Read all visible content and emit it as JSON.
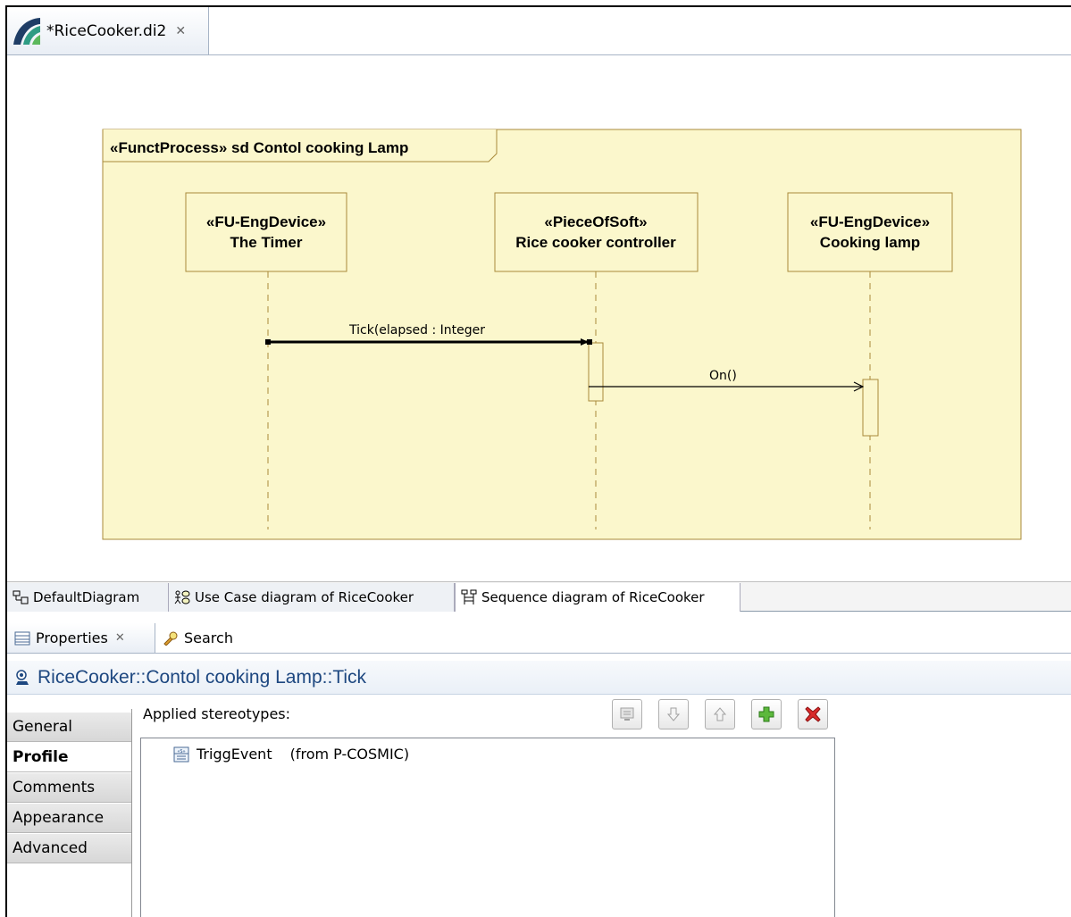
{
  "editor": {
    "tab_title": "*RiceCooker.di2"
  },
  "diagram": {
    "frame_label": "«FunctProcess»  sd  Contol cooking Lamp",
    "lifelines": [
      {
        "stereotype": "«FU-EngDevice»",
        "name": "The Timer"
      },
      {
        "stereotype": "«PieceOfSoft»",
        "name": "Rice cooker controller"
      },
      {
        "stereotype": "«FU-EngDevice»",
        "name": "Cooking lamp"
      }
    ],
    "messages": [
      {
        "label": "Tick(elapsed : Integer"
      },
      {
        "label": "On()"
      }
    ],
    "colors": {
      "fill": "#fbf7cc",
      "border": "#a88a3a"
    }
  },
  "diagram_tabs": [
    {
      "label": "DefaultDiagram"
    },
    {
      "label": "Use Case diagram of RiceCooker"
    },
    {
      "label": "Sequence diagram of RiceCooker"
    }
  ],
  "properties": {
    "tabs": [
      {
        "label": "Properties"
      },
      {
        "label": "Search"
      }
    ],
    "title": "RiceCooker::Contol cooking Lamp::Tick",
    "side_tabs": [
      {
        "label": "General"
      },
      {
        "label": "Profile"
      },
      {
        "label": "Comments"
      },
      {
        "label": "Appearance"
      },
      {
        "label": "Advanced"
      }
    ],
    "applied_stereotypes_label": "Applied stereotypes:",
    "stereotypes": [
      {
        "name": "TriggEvent",
        "from": "(from P-COSMIC)"
      }
    ],
    "toolbar": {
      "icons": [
        "edit-icon",
        "move-down-icon",
        "move-up-icon",
        "add-icon",
        "delete-icon"
      ]
    }
  }
}
